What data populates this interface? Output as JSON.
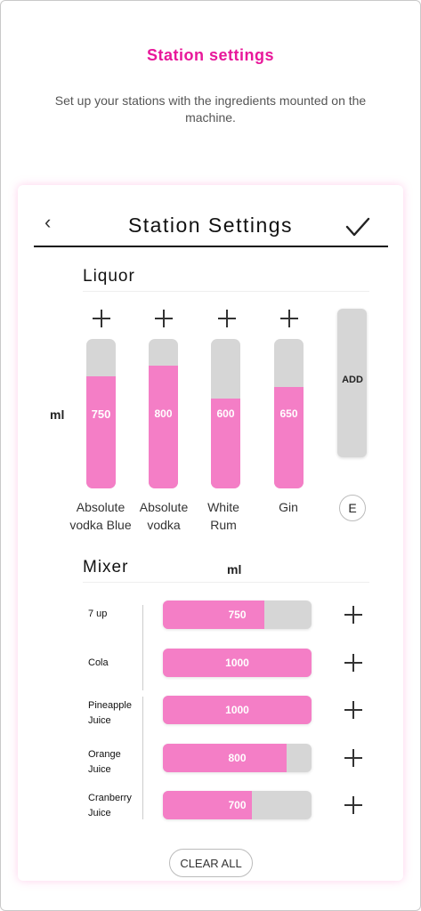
{
  "page": {
    "title": "Station settings",
    "subtitle": "Set up your stations with the ingredients mounted on the machine."
  },
  "card": {
    "title": "Station Settings",
    "back_icon": "chevron-left-icon",
    "confirm_icon": "check-icon"
  },
  "liquor": {
    "section_title": "Liquor",
    "unit_label": "ml",
    "stations": [
      {
        "name_line1": "Absolute",
        "name_line2": "vodka Blue",
        "value": "750",
        "fill_fraction": 0.75
      },
      {
        "name_line1": "Absolute",
        "name_line2": "vodka",
        "value": "800",
        "fill_fraction": 0.82
      },
      {
        "name_line1": "White",
        "name_line2": "Rum",
        "value": "600",
        "fill_fraction": 0.6
      },
      {
        "name_line1": "Gin",
        "name_line2": "",
        "value": "650",
        "fill_fraction": 0.68
      }
    ],
    "add_label": "ADD",
    "e_label": "E"
  },
  "mixer": {
    "section_title": "Mixer",
    "unit_label": "ml",
    "items": [
      {
        "name_line1": "7 up",
        "name_line2": "",
        "value": "750",
        "fill_fraction": 0.68
      },
      {
        "name_line1": "Cola",
        "name_line2": "",
        "value": "1000",
        "fill_fraction": 1.0
      },
      {
        "name_line1": "Pineapple",
        "name_line2": "Juice",
        "value": "1000",
        "fill_fraction": 1.0
      },
      {
        "name_line1": "Orange",
        "name_line2": "Juice",
        "value": "800",
        "fill_fraction": 0.83
      },
      {
        "name_line1": "Cranberry",
        "name_line2": "Juice",
        "value": "700",
        "fill_fraction": 0.6
      }
    ]
  },
  "footer": {
    "clear_label": "CLEAR ALL"
  },
  "colors": {
    "accent": "#e8189a",
    "fill": "#f47ec6",
    "track": "#d6d6d6"
  }
}
